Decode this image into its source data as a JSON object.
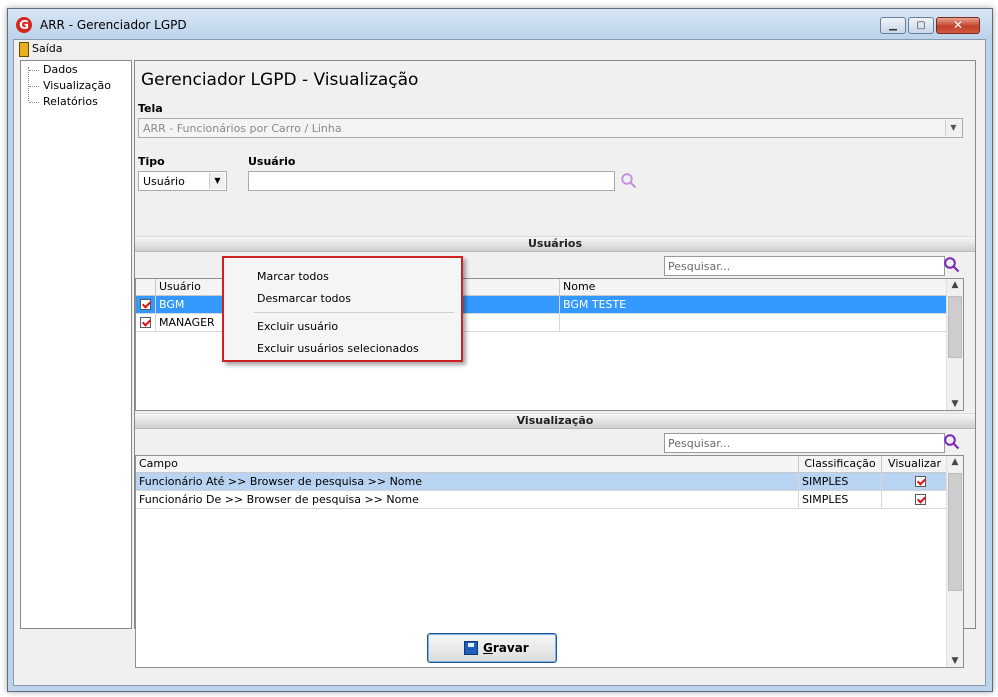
{
  "window": {
    "title": "ARR - Gerenciador LGPD",
    "icon": "app-logo-icon"
  },
  "menu": {
    "exit_label": "Saída"
  },
  "nav": {
    "items": [
      "Dados",
      "Visualização",
      "Relatórios"
    ]
  },
  "page": {
    "title": "Gerenciador LGPD - Visualização"
  },
  "form": {
    "tela_label": "Tela",
    "tela_value": "ARR - Funcionários por Carro / Linha",
    "tipo_label": "Tipo",
    "tipo_value": "Usuário",
    "usuario_label": "Usuário",
    "usuario_value": ""
  },
  "users_section": {
    "title": "Usuários",
    "search_placeholder": "Pesquisar...",
    "columns": [
      "Usuário",
      "Nome"
    ],
    "rows": [
      {
        "checked": true,
        "usuario": "BGM",
        "nome": "BGM TESTE",
        "selected": true
      },
      {
        "checked": true,
        "usuario": "MANAGER",
        "nome": "",
        "selected": false
      }
    ]
  },
  "context_menu": {
    "items": [
      "Marcar todos",
      "Desmarcar todos",
      "Excluir usuário",
      "Excluir usuários selecionados"
    ]
  },
  "view_section": {
    "title": "Visualização",
    "search_placeholder": "Pesquisar...",
    "columns": [
      "Campo",
      "Classificação",
      "Visualizar"
    ],
    "rows": [
      {
        "campo": "Funcionário Até >> Browser de pesquisa >> Nome",
        "classificacao": "SIMPLES",
        "visualizar": true,
        "selected": true
      },
      {
        "campo": "Funcionário De >> Browser de pesquisa >> Nome",
        "classificacao": "SIMPLES",
        "visualizar": true,
        "selected": false
      }
    ]
  },
  "footer": {
    "save_label_first": "G",
    "save_label_rest": "ravar"
  },
  "colors": {
    "selection": "#3399ff",
    "selection_light": "#b8d4f2",
    "highlight_border": "#cc2222",
    "search_icon": "#7a2ab8"
  }
}
